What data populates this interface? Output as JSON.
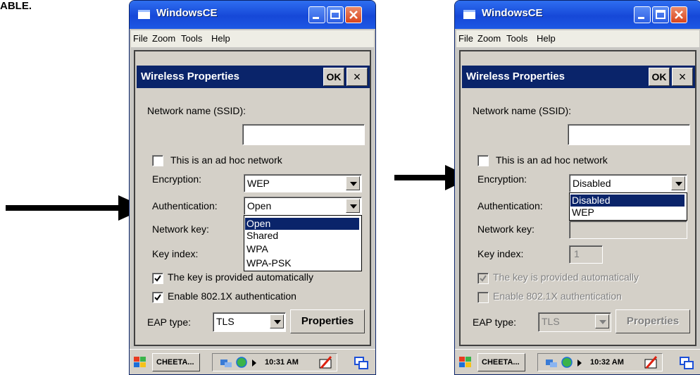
{
  "caption": "ABLE.",
  "windows": [
    {
      "title": "WindowsCE",
      "menu": [
        "File",
        "Zoom",
        "Tools",
        "Help"
      ],
      "dialog": {
        "title": "Wireless Properties",
        "ok": "OK",
        "close": "×",
        "ssid_label": "Network name (SSID):",
        "ssid_value": "",
        "adhoc_label": "This is an ad hoc network",
        "adhoc_checked": false,
        "encryption_label": "Encryption:",
        "encryption_value": "WEP",
        "auth_label": "Authentication:",
        "auth_value": "Open",
        "auth_options": [
          "Open",
          "Shared",
          "WPA",
          "WPA-PSK"
        ],
        "auth_selected": "Open",
        "netkey_label": "Network key:",
        "keyindex_label": "Key index:",
        "keyindex_value": "",
        "autokey_label": "The key is provided automatically",
        "autokey_checked": true,
        "enable8021x_label": "Enable 802.1X authentication",
        "enable8021x_checked": true,
        "eap_label": "EAP type:",
        "eap_value": "TLS",
        "properties_label": "Properties"
      },
      "taskbar": {
        "item": "CHEETA...",
        "time": "10:31 AM"
      }
    },
    {
      "title": "WindowsCE",
      "menu": [
        "File",
        "Zoom",
        "Tools",
        "Help"
      ],
      "dialog": {
        "title": "Wireless Properties",
        "ok": "OK",
        "close": "×",
        "ssid_label": "Network name (SSID):",
        "ssid_value": "",
        "adhoc_label": "This is an ad hoc network",
        "adhoc_checked": false,
        "encryption_label": "Encryption:",
        "encryption_value": "Disabled",
        "encryption_options": [
          "Disabled",
          "WEP"
        ],
        "encryption_selected": "Disabled",
        "auth_label": "Authentication:",
        "netkey_label": "Network key:",
        "keyindex_label": "Key index:",
        "keyindex_value": "1",
        "autokey_label": "The key is provided automatically",
        "autokey_checked": true,
        "enable8021x_label": "Enable 802.1X authentication",
        "enable8021x_checked": false,
        "eap_label": "EAP type:",
        "eap_value": "TLS",
        "properties_label": "Properties"
      },
      "taskbar": {
        "item": "CHEETA...",
        "time": "10:32 AM"
      }
    }
  ],
  "colors": {
    "titlebar": "#2459e4",
    "dialog_title": "#0a246a",
    "face": "#d4d0c8",
    "selection": "#0a246a"
  }
}
